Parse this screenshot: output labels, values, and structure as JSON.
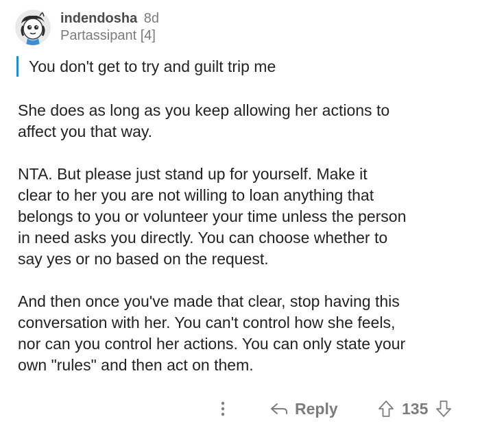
{
  "comment": {
    "username": "indendosha",
    "age": "8d",
    "flair": "Partassipant [4]",
    "quote": "You don't get to try and guilt trip me",
    "paragraphs": [
      "She does as long as you keep allowing her actions to\naffect you that way.",
      "NTA. But please just stand up for yourself.  Make it\nclear to her you are not willing to loan anything that\nbelongs to you or volunteer your time unless the person\nin need asks you directly. You can choose whether to\nsay yes or no based on the request.",
      "And then once you've made that clear, stop having this\nconversation with her. You can't control how she feels,\nnor can you control her actions. You can only state your\nown \"rules\" and then act on them."
    ]
  },
  "actions": {
    "more_icon": "more-vertical-icon",
    "reply_icon": "reply-arrow-icon",
    "reply_label": "Reply",
    "upvote_icon": "arrow-up-outline-icon",
    "vote_count": "135",
    "downvote_icon": "arrow-down-outline-icon"
  },
  "colors": {
    "quote_bar": "#1e8bd4",
    "meta_text": "#7a7a7a",
    "action_text": "#7c7c7c"
  }
}
